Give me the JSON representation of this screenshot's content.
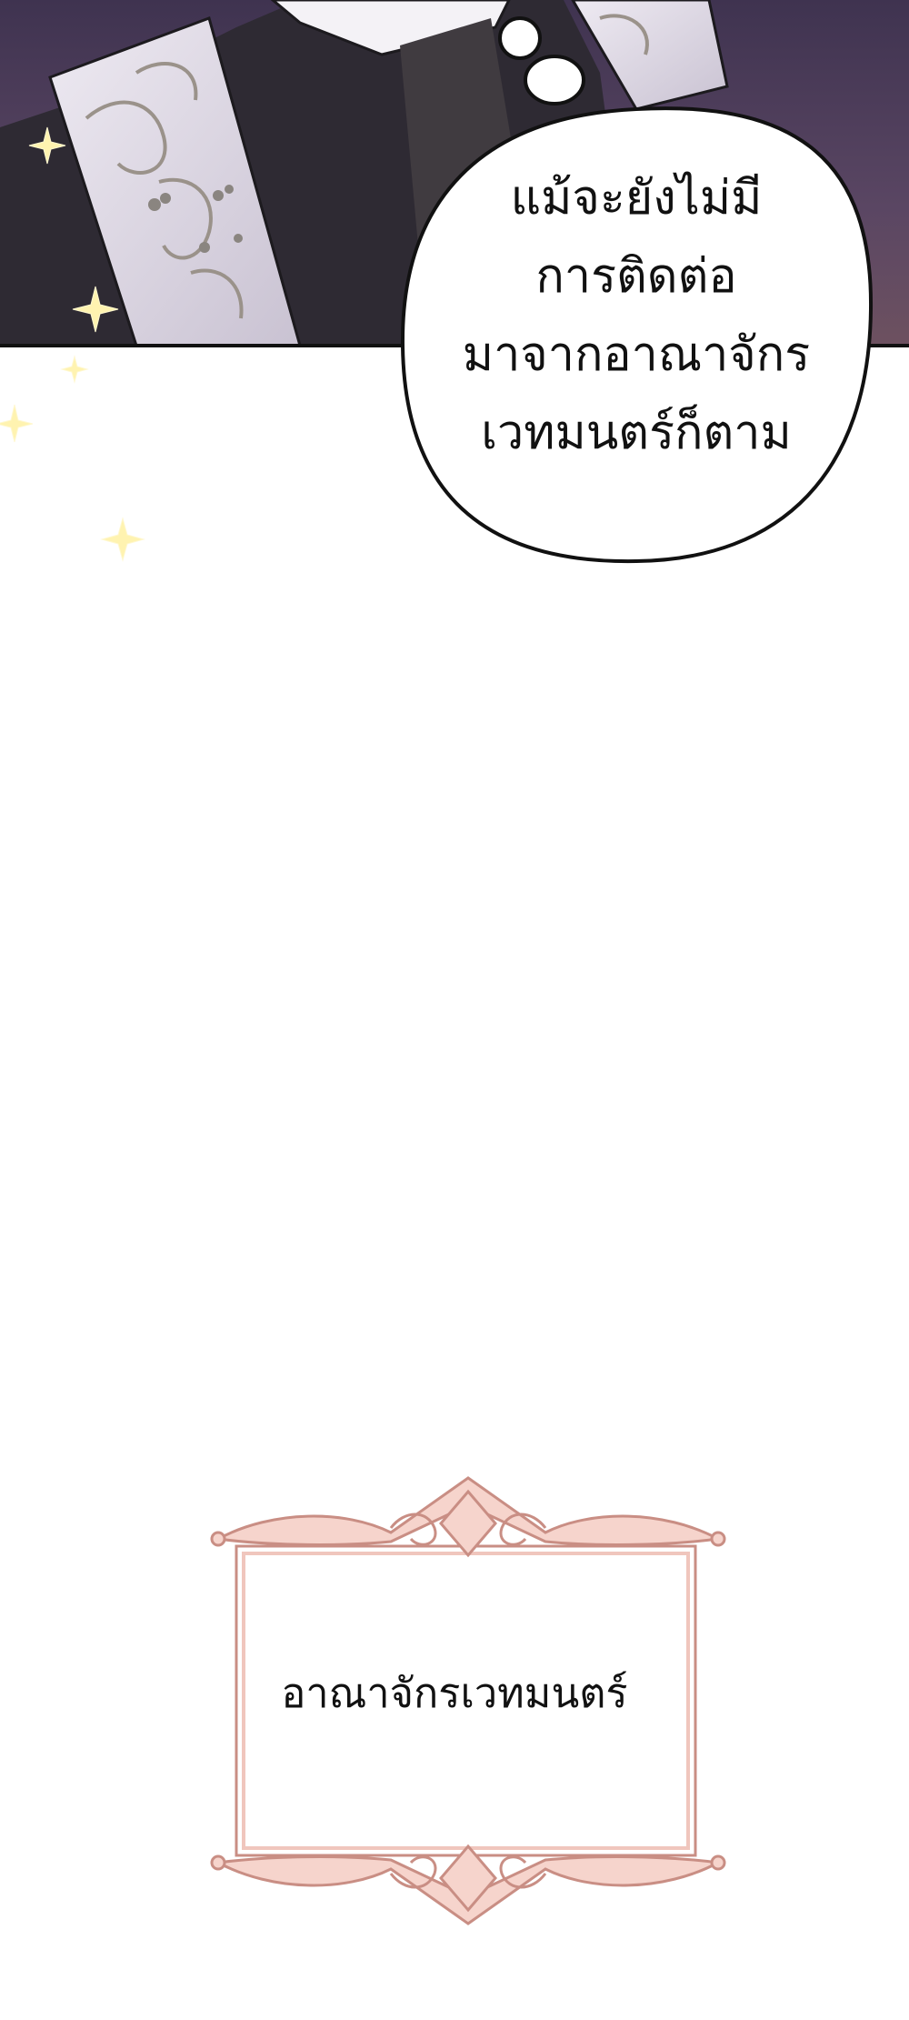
{
  "speech_bubble": {
    "lines": [
      "แม้จะยังไม่มี",
      "การติดต่อ",
      "มาจากอาณาจักร",
      "เวทมนตร์ก็ตาม"
    ]
  },
  "caption": {
    "text": "อาณาจักรเวทมนตร์"
  },
  "colors": {
    "panel_background": "#4a3a5a",
    "panel_border": "#111111",
    "garment_light": "#e8e4ee",
    "garment_dark": "#2e2a30",
    "ornament_gold": "#a09890",
    "sparkle": "#fff3b0",
    "frame_pink": "#f3c9c0",
    "frame_outline": "#c98e84"
  },
  "icons": [
    "sparkle-icon",
    "ornate-frame-icon"
  ]
}
